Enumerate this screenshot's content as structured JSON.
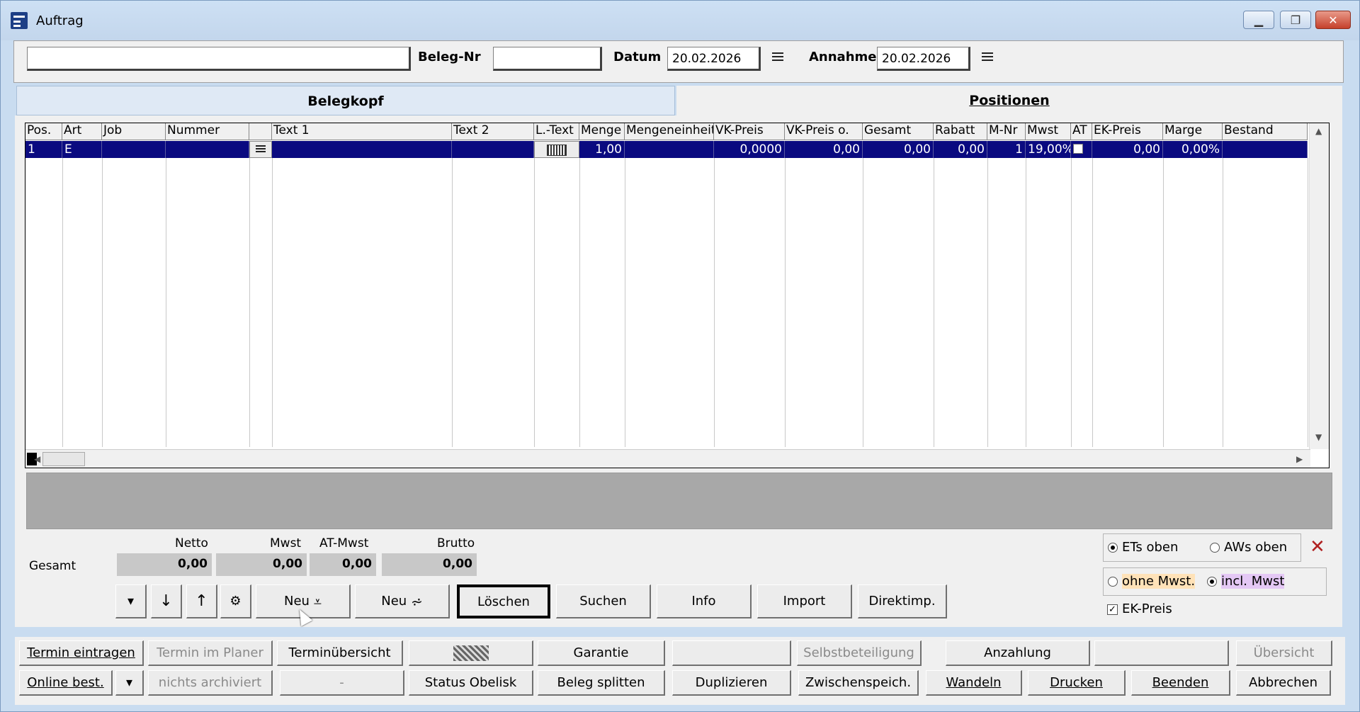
{
  "window": {
    "title": "Auftrag"
  },
  "header": {
    "main_field": "",
    "beleg_nr_label": "Beleg-Nr",
    "beleg_nr_value": "",
    "datum_label": "Datum",
    "datum_value": "20.02.2026",
    "annahme_label": "Annahme",
    "annahme_value": "20.02.2026"
  },
  "tabs": {
    "kopf": "Belegkopf",
    "positionen": "Positionen"
  },
  "grid": {
    "columns": [
      "Pos.",
      "Art",
      "Job",
      "Nummer",
      "",
      "Text 1",
      "Text 2",
      "L.-Text",
      "Menge",
      "Mengeneinheit",
      "VK-Preis",
      "VK-Preis o.",
      "Gesamt",
      "Rabatt",
      "M-Nr",
      "Mwst",
      "AT",
      "EK-Preis",
      "Marge",
      "Bestand"
    ],
    "row": {
      "pos": "1",
      "art": "E",
      "job": "",
      "nummer": "",
      "text1": "",
      "text2": "",
      "menge": "1,00",
      "einheit": "",
      "vk_preis": "0,0000",
      "vk_preis_o": "0,00",
      "gesamt": "0,00",
      "rabatt": "0,00",
      "m_nr": "1",
      "mwst": "19,00%",
      "ek_preis": "0,00",
      "marge": "0,00%",
      "bestand": ""
    }
  },
  "summary": {
    "gesamt_label": "Gesamt",
    "netto_label": "Netto",
    "netto_value": "0,00",
    "mwst_label": "Mwst",
    "mwst_value": "0,00",
    "atmwst_label": "AT-Mwst",
    "atmwst_value": "0,00",
    "brutto_label": "Brutto",
    "brutto_value": "0,00"
  },
  "actions": {
    "neu1": "Neu",
    "neu2": "Neu",
    "loeschen": "Löschen",
    "suchen": "Suchen",
    "info": "Info",
    "import": "Import",
    "direktimp": "Direktimp."
  },
  "options": {
    "ets_oben": "ETs oben",
    "aws_oben": "AWs oben",
    "ohne_mwst": "ohne Mwst.",
    "incl_mwst": "incl. Mwst",
    "ek_preis": "EK-Preis"
  },
  "bottom": {
    "row1": [
      "Termin eintragen",
      "Termin im Planer",
      "Terminübersicht",
      "",
      "Garantie",
      "",
      "Selbstbeteiligung",
      "Anzahlung",
      "",
      "Übersicht"
    ],
    "row2": [
      "Online best.",
      "nichts archiviert",
      "-",
      "Status Obelisk",
      "Beleg splitten",
      "Duplizieren",
      "Zwischenspeich.",
      "Wandeln",
      "Drucken",
      "Beenden",
      "Abbrechen"
    ]
  }
}
